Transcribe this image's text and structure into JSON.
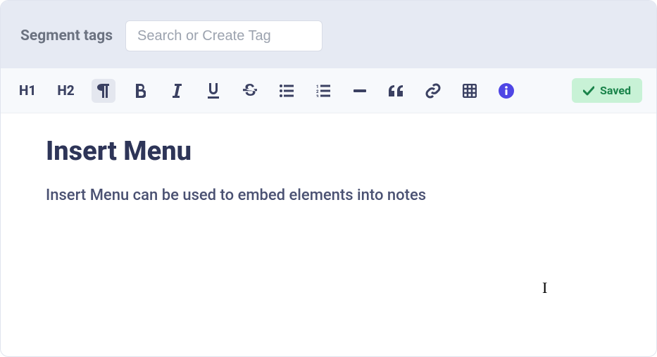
{
  "topbar": {
    "label": "Segment tags",
    "search_placeholder": "Search or Create Tag"
  },
  "toolbar": {
    "h1": "H1",
    "h2": "H2",
    "saved_label": "Saved"
  },
  "editor": {
    "title": "Insert Menu",
    "body": "Insert Menu can be used to embed elements into notes"
  }
}
